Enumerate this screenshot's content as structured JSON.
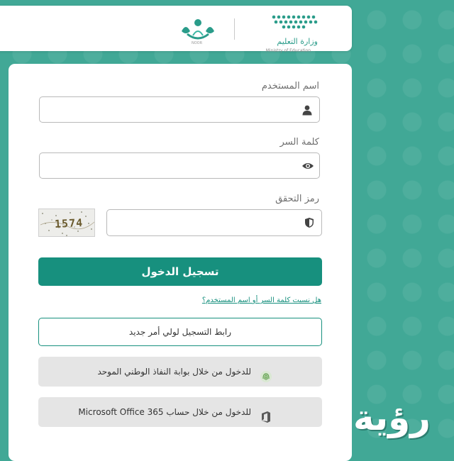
{
  "header": {
    "ministry_name": "وزارة التعليم",
    "ministry_subtitle": "Ministry of Education",
    "noor_caption": "NOOR"
  },
  "form": {
    "username_label": "اسم المستخدم",
    "username_value": "",
    "password_label": "كلمة السر",
    "password_value": "",
    "captcha_label": "رمز التحقق",
    "captcha_value": "",
    "captcha_image_code": "1574"
  },
  "buttons": {
    "login_label": "تسجيل الدخول",
    "forgot_link": "هل نسيت كلمة السر أو اسم المستخدم؟",
    "guardian_register": "رابط التسجيل لولي أمر جديد",
    "nafath_login": "للدخول من خلال بوابة النفاذ الوطني الموحد",
    "office_login": "للدخول من خلال حساب Microsoft Office 365"
  },
  "watermark": {
    "text": "رؤية"
  },
  "colors": {
    "accent": "#17907e",
    "background": "#41a896",
    "gray_button": "#e5e5e5"
  },
  "icons": {
    "username": "user-icon",
    "password": "eye-icon",
    "captcha": "shield-icon",
    "nafath": "fingerprint-icon",
    "office": "office-icon"
  }
}
